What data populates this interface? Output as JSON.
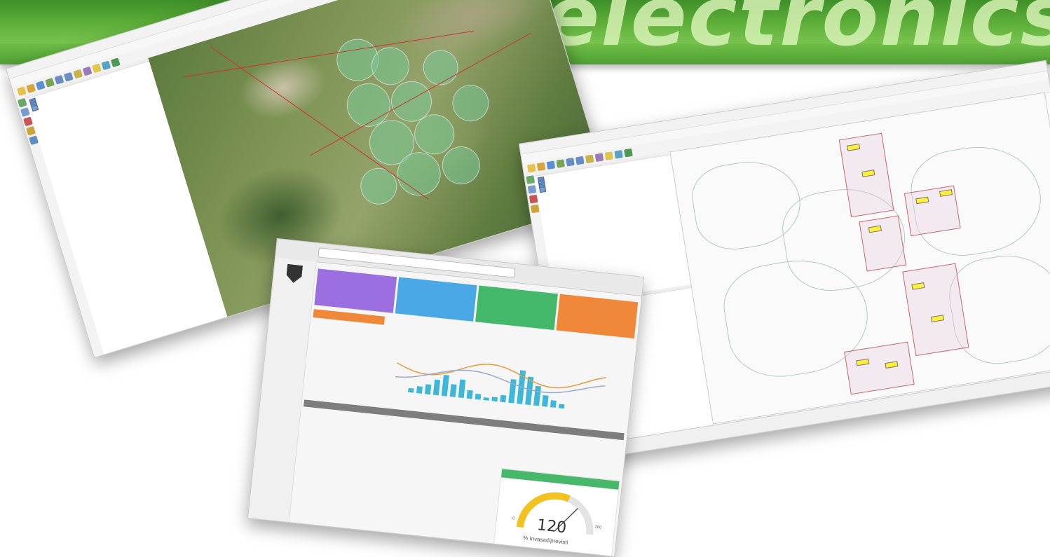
{
  "banner": {
    "brand_text": "electronics",
    "colors": {
      "green_dark": "#3f8f2a",
      "green_light": "#98d66c",
      "text": "#d6f2b4"
    }
  },
  "qgis_left": {
    "icons": [
      "new-project-icon",
      "open-icon",
      "save-icon",
      "pan-icon",
      "zoom-in-icon",
      "zoom-out-icon",
      "identify-icon",
      "measure-icon",
      "select-icon",
      "attribute-table-icon",
      "refresh-icon"
    ],
    "layer_colors": [
      "#7a9bd0",
      "#6aa86a",
      "#d0a23a",
      "#c85454"
    ]
  },
  "qgis_right": {
    "tile_tag_color": "#ffef3a",
    "tile_border_color": "#c46a6a"
  },
  "dashboard": {
    "cards": [
      {
        "color": "#9b6fe0"
      },
      {
        "color": "#4aa8e6"
      },
      {
        "color": "#43b86a"
      },
      {
        "color": "#f0883a"
      }
    ],
    "gauge": {
      "value": "120",
      "min": "0",
      "max": "200",
      "caption": "% Invasati/previsti",
      "fraction": 0.6,
      "arc_color": "#f2c21e"
    }
  }
}
